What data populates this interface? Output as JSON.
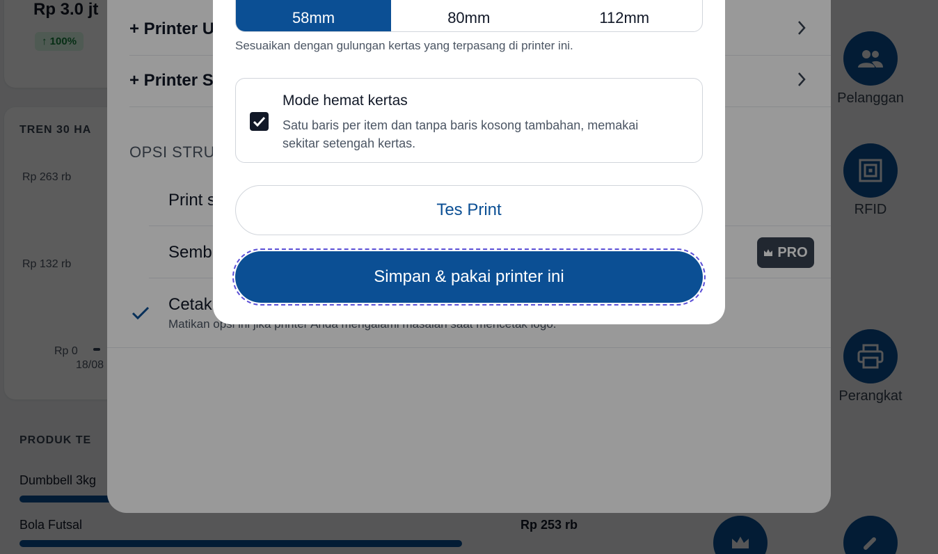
{
  "dashboard": {
    "stat_value": "Rp 3.0 jt",
    "stat_change": "↑ 100%",
    "trend_title": "TREN 30 HA",
    "y_axis": [
      "Rp 263 rb",
      "Rp 132 rb",
      "Rp 0"
    ],
    "x_axis_first": "18/08",
    "products_title": "PRODUK TE",
    "products": [
      {
        "name": "Dumbbell 3kg",
        "value": ""
      },
      {
        "name": "Bola Futsal",
        "value": "Rp 253 rb"
      }
    ],
    "side_nav": [
      {
        "label": "Pelanggan",
        "icon": "users-icon"
      },
      {
        "label": "RFID",
        "icon": "rfid-icon"
      },
      {
        "label": "Perangkat",
        "icon": "printer-icon"
      }
    ]
  },
  "sheet": {
    "rows": [
      "+ Printer U",
      "+ Printer S"
    ],
    "opsi_title": "OPSI STRU",
    "options": [
      "Print s",
      "Semb",
      "Cetak"
    ],
    "pro_badge": "PRO",
    "cetak_hint": "Matikan opsi ini jika printer Anda mengalami masalah saat mencetak logo."
  },
  "dialog": {
    "paper_sizes": [
      "58mm",
      "80mm",
      "112mm"
    ],
    "selected_size": "58mm",
    "paper_hint": "Sesuaikan dengan gulungan kertas yang terpasang di printer ini.",
    "mode_title": "Mode hemat kertas",
    "mode_desc": "Satu baris per item dan tanpa baris kosong tambahan, memakai sekitar setengah kertas.",
    "mode_checked": true,
    "test_button": "Tes Print",
    "save_button": "Simpan & pakai printer ini"
  },
  "colors": {
    "primary": "#0b4f94",
    "success_bg": "#dcfce7",
    "success_text": "#15803d",
    "focus_outline": "#5b4fd6"
  }
}
